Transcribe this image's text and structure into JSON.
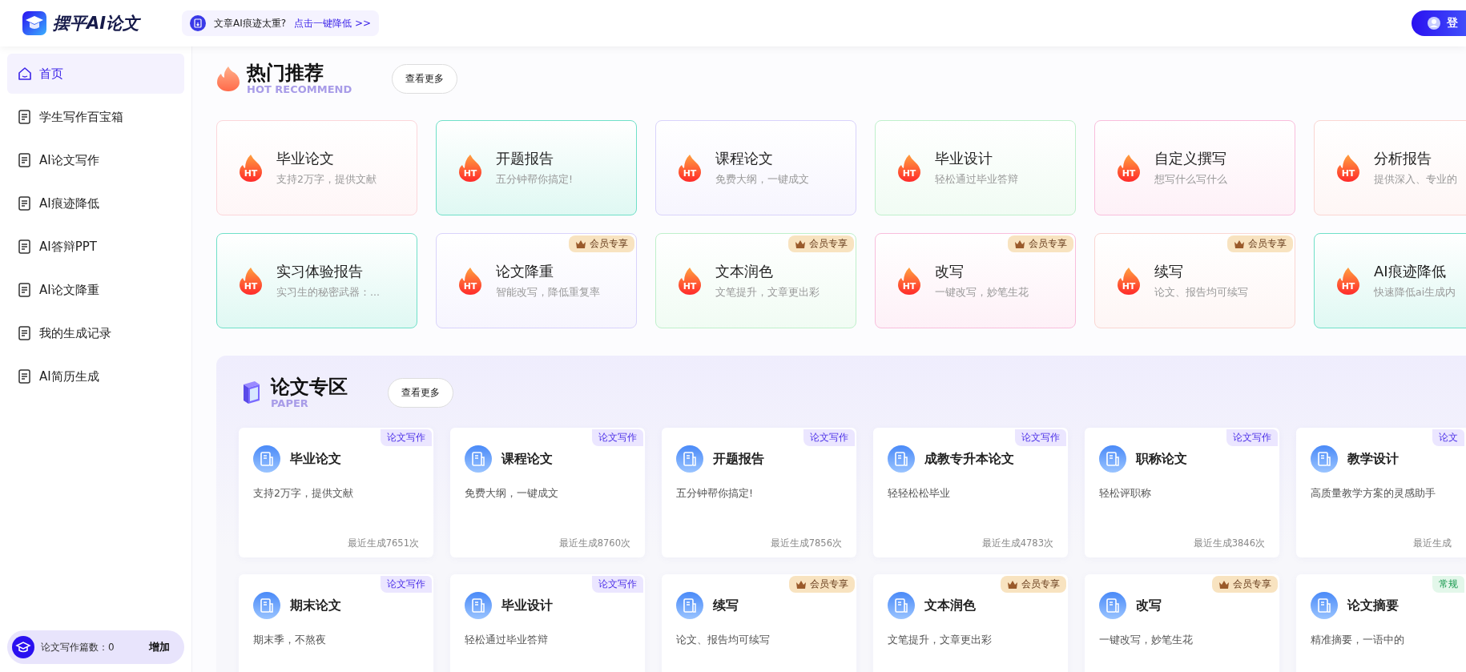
{
  "header": {
    "logo_text": "摆平AI论文",
    "banner": {
      "question": "文章AI痕迹太重?",
      "link": "点击一键降低 >>"
    },
    "login": "登"
  },
  "sidebar": {
    "items": [
      {
        "label": "首页",
        "kind": "home",
        "selected": true
      },
      {
        "label": "学生写作百宝箱",
        "kind": "doc",
        "selected": false
      },
      {
        "label": "AI论文写作",
        "kind": "doc",
        "selected": false
      },
      {
        "label": "AI痕迹降低",
        "kind": "doc",
        "selected": false
      },
      {
        "label": "AI答辩PPT",
        "kind": "doc",
        "selected": false
      },
      {
        "label": "AI论文降重",
        "kind": "doc",
        "selected": false
      },
      {
        "label": "我的生成记录",
        "kind": "doc",
        "selected": false
      },
      {
        "label": "AI简历生成",
        "kind": "doc",
        "selected": false
      }
    ],
    "counter": {
      "label": "论文写作篇数：0",
      "action": "增加"
    }
  },
  "hot": {
    "title": "热门推荐",
    "subtitle": "HOT RECOMMEND",
    "more": "查看更多",
    "rows": [
      [
        {
          "title": "毕业论文",
          "desc": "支持2万字，提供文献",
          "badge": "HT",
          "color": "#fcd6da"
        },
        {
          "title": "开题报告",
          "desc": "五分钟帮你搞定!",
          "badge": "HT",
          "color": "#6fe0c8"
        },
        {
          "title": "课程论文",
          "desc": "免费大纲，一键成文",
          "badge": "HT",
          "color": "#d9d3fb"
        },
        {
          "title": "毕业设计",
          "desc": "轻松通过毕业答辩",
          "badge": "HT",
          "color": "#bff0cb"
        },
        {
          "title": "自定义撰写",
          "desc": "想写什么写什么",
          "badge": "HT",
          "color": "#f9bedc"
        },
        {
          "title": "分析报告",
          "desc": "提供深入、专业的",
          "badge": "HT",
          "color": "#fad6d2"
        }
      ],
      [
        {
          "title": "实习体验报告",
          "desc": "实习生的秘密武器：...",
          "badge": "HT",
          "color": "#6fe0c8"
        },
        {
          "title": "论文降重",
          "desc": "智能改写，降低重复率",
          "badge": "HT",
          "color": "#d9d3fb",
          "tag": {
            "kind": "vip",
            "text": "会员专享"
          }
        },
        {
          "title": "文本润色",
          "desc": "文笔提升，文章更出彩",
          "badge": "HT",
          "color": "#bff0cb",
          "tag": {
            "kind": "vip",
            "text": "会员专享"
          }
        },
        {
          "title": "改写",
          "desc": "一键改写，妙笔生花",
          "badge": "HT",
          "color": "#f9bedc",
          "tag": {
            "kind": "vip",
            "text": "会员专享"
          }
        },
        {
          "title": "续写",
          "desc": "论文、报告均可续写",
          "badge": "HT",
          "color": "#fad6d2",
          "tag": {
            "kind": "vip",
            "text": "会员专享"
          }
        },
        {
          "title": "AI痕迹降低",
          "desc": "快速降低ai生成内",
          "badge": "HT",
          "color": "#6fe0c8"
        }
      ]
    ]
  },
  "paper": {
    "title": "论文专区",
    "subtitle": "PAPER",
    "more": "查看更多",
    "rows": [
      [
        {
          "title": "毕业论文",
          "desc": "支持2万字，提供文献",
          "count": "最近生成7651次",
          "tag": {
            "kind": "writing",
            "text": "论文写作"
          }
        },
        {
          "title": "课程论文",
          "desc": "免费大纲，一键成文",
          "count": "最近生成8760次",
          "tag": {
            "kind": "writing",
            "text": "论文写作"
          }
        },
        {
          "title": "开题报告",
          "desc": "五分钟帮你搞定!",
          "count": "最近生成7856次",
          "tag": {
            "kind": "writing",
            "text": "论文写作"
          }
        },
        {
          "title": "成教专升本论文",
          "desc": "轻轻松松毕业",
          "count": "最近生成4783次",
          "tag": {
            "kind": "writing",
            "text": "论文写作"
          }
        },
        {
          "title": "职称论文",
          "desc": "轻松评职称",
          "count": "最近生成3846次",
          "tag": {
            "kind": "writing",
            "text": "论文写作"
          }
        },
        {
          "title": "教学设计",
          "desc": "高质量教学方案的灵感助手",
          "count": "最近生成",
          "tag": {
            "kind": "writing",
            "text": "论文"
          }
        }
      ],
      [
        {
          "title": "期末论文",
          "desc": "期末季，不熬夜",
          "tag": {
            "kind": "writing",
            "text": "论文写作"
          }
        },
        {
          "title": "毕业设计",
          "desc": "轻松通过毕业答辩",
          "tag": {
            "kind": "writing",
            "text": "论文写作"
          }
        },
        {
          "title": "续写",
          "desc": "论文、报告均可续写",
          "tag": {
            "kind": "vip",
            "text": "会员专享"
          }
        },
        {
          "title": "文本润色",
          "desc": "文笔提升，文章更出彩",
          "tag": {
            "kind": "vip",
            "text": "会员专享"
          }
        },
        {
          "title": "改写",
          "desc": "一键改写，妙笔生花",
          "tag": {
            "kind": "vip",
            "text": "会员专享"
          }
        },
        {
          "title": "论文摘要",
          "desc": "精准摘要，一语中的",
          "tag": {
            "kind": "normal",
            "text": "常规"
          }
        }
      ]
    ]
  }
}
